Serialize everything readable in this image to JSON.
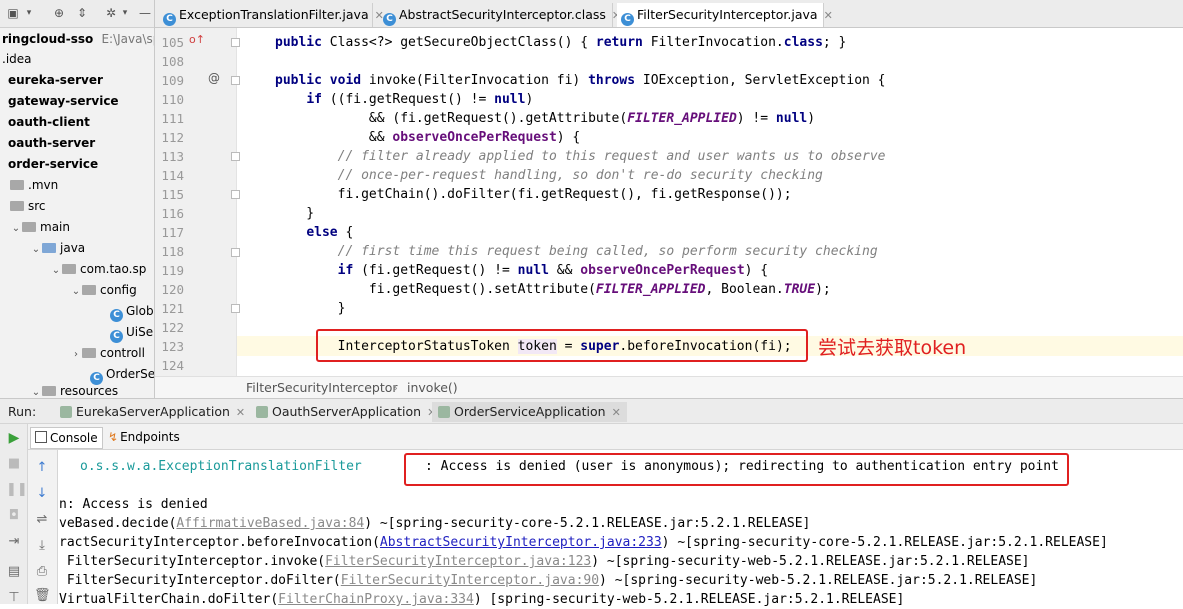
{
  "project": {
    "root_name": "ringcloud-sso",
    "root_path": "E:\\Java\\sp",
    "items": [
      {
        "label": ".idea",
        "level": "plain"
      },
      {
        "label": "eureka-server",
        "level": "bold"
      },
      {
        "label": "gateway-service",
        "level": "bold"
      },
      {
        "label": "oauth-client",
        "level": "bold"
      },
      {
        "label": "oauth-server",
        "level": "bold"
      },
      {
        "label": "order-service",
        "level": "bold"
      },
      {
        "label": ".mvn"
      },
      {
        "label": "src"
      },
      {
        "label": "main"
      },
      {
        "label": "java"
      },
      {
        "label": "com.tao.sp"
      },
      {
        "label": "config"
      },
      {
        "label": "Glob"
      },
      {
        "label": "UiSe"
      },
      {
        "label": "controll"
      },
      {
        "label": "OrderSe"
      },
      {
        "label": "resources"
      }
    ]
  },
  "tabs": [
    {
      "label": "ExceptionTranslationFilter.java"
    },
    {
      "label": "AbstractSecurityInterceptor.class"
    },
    {
      "label": "FilterSecurityInterceptor.java"
    }
  ],
  "editor": {
    "line_numbers": [
      "105",
      "108",
      "109",
      "110",
      "111",
      "112",
      "113",
      "114",
      "115",
      "116",
      "117",
      "118",
      "119",
      "120",
      "121",
      "122",
      "123",
      "124"
    ],
    "annotation": "尝试去获取token",
    "breadcrumb": [
      "FilterSecurityInterceptor",
      "invoke()"
    ]
  },
  "run": {
    "label": "Run:",
    "tabs": [
      "EurekaServerApplication",
      "OauthServerApplication",
      "OrderServiceApplication"
    ],
    "subtabs": [
      "Console",
      "Endpoints"
    ],
    "console": {
      "logger": "o.s.s.w.a.ExceptionTranslationFilter",
      "message": ": Access is denied (user is anonymous); redirecting to authentication entry point",
      "l1": "n: Access is denied",
      "l2_pre": "veBased.decide(",
      "l2_link": "AffirmativeBased.java:84",
      "l2_post": ") ~[spring-security-core-5.2.1.RELEASE.jar:5.2.1.RELEASE]",
      "l3_pre": "ractSecurityInterceptor.beforeInvocation(",
      "l3_link": "AbstractSecurityInterceptor.java:233",
      "l3_post": ") ~[spring-security-core-5.2.1.RELEASE.jar:5.2.1.RELEASE]",
      "l4_pre": " FilterSecurityInterceptor.invoke(",
      "l4_link": "FilterSecurityInterceptor.java:123",
      "l4_post": ") ~[spring-security-web-5.2.1.RELEASE.jar:5.2.1.RELEASE]",
      "l5_pre": " FilterSecurityInterceptor.doFilter(",
      "l5_link": "FilterSecurityInterceptor.java:90",
      "l5_post": ") ~[spring-security-web-5.2.1.RELEASE.jar:5.2.1.RELEASE]",
      "l6_pre": "VirtualFilterChain.doFilter(",
      "l6_link": "FilterChainProxy.java:334",
      "l6_post": ") [spring-security-web-5.2.1.RELEASE.jar:5.2.1.RELEASE]"
    }
  }
}
